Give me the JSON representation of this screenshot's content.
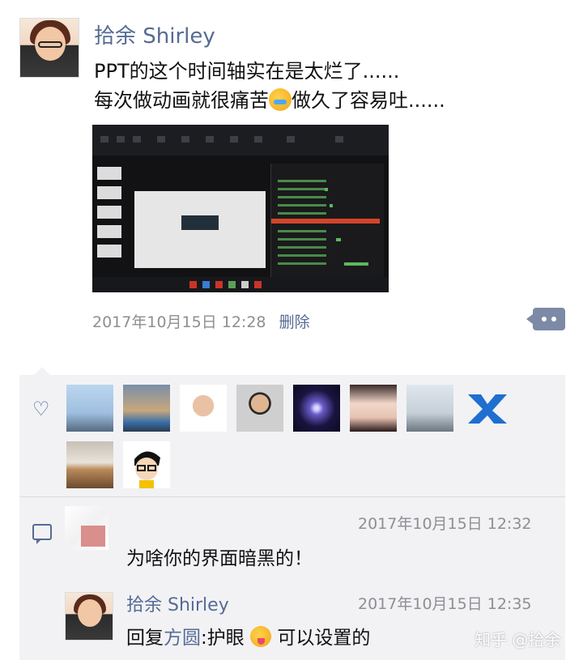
{
  "post": {
    "author": "拾余 Shirley",
    "text_line1": "PPT的这个时间轴实在是太烂了......",
    "text_line2_a": "每次做动画就很痛苦",
    "text_line2_b": "做久了容易吐......",
    "timestamp": "2017年10月15日 12:28",
    "delete_label": "删除"
  },
  "likes": {
    "count_visible": 10
  },
  "comments": [
    {
      "time": "2017年10月15日 12:32",
      "text": "为啥你的界面暗黑的！"
    },
    {
      "name": "拾余 Shirley",
      "time": "2017年10月15日 12:35",
      "reply_prefix": "回复",
      "reply_to": "方圆",
      "text_a": ":护眼",
      "text_b": "可以设置的"
    }
  ],
  "watermark": "知乎 @拾余",
  "colors": {
    "link": "#566b94",
    "meta": "#8e8e93",
    "likes_bg": "#f2f2f5"
  },
  "icons": [
    "heart-icon",
    "comment-icon",
    "more-icon",
    "crying-face-emoji",
    "tongue-face-emoji"
  ]
}
